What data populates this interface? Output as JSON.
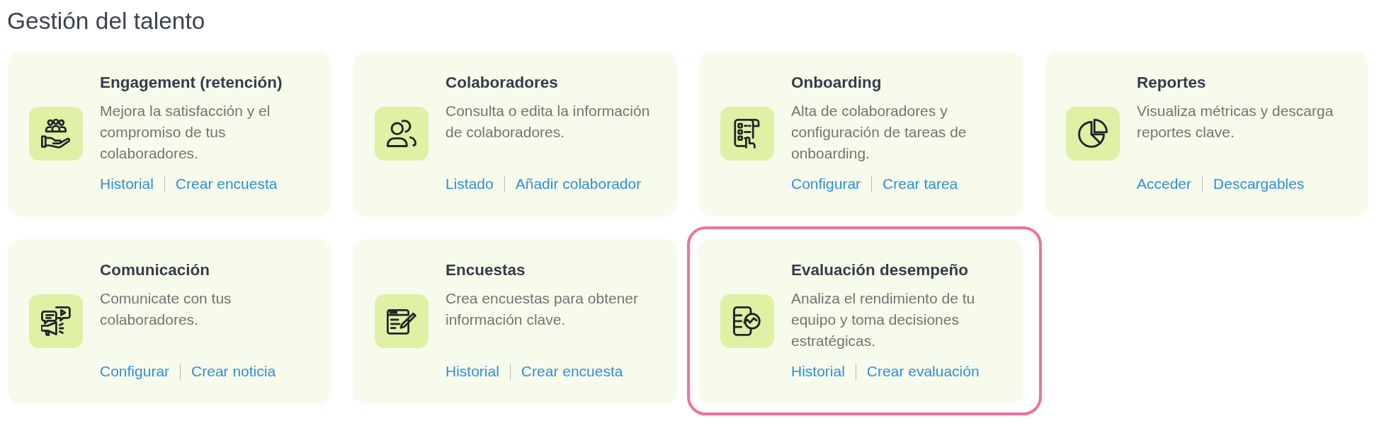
{
  "page": {
    "title": "Gestión del talento"
  },
  "cards": [
    {
      "title": "Engagement (retención)",
      "description": "Mejora la satisfacción y el compromiso de tus colaboradores.",
      "links": [
        "Historial",
        "Crear encuesta"
      ],
      "highlighted": false
    },
    {
      "title": "Colaboradores",
      "description": "Consulta o edita la información de colaboradores.",
      "links": [
        "Listado",
        "Añadir colaborador"
      ],
      "highlighted": false
    },
    {
      "title": "Onboarding",
      "description": "Alta de colaboradores y configuración de tareas de onboarding.",
      "links": [
        "Configurar",
        "Crear tarea"
      ],
      "highlighted": false
    },
    {
      "title": "Reportes",
      "description": "Visualiza métricas y descarga reportes clave.",
      "links": [
        "Acceder",
        "Descargables"
      ],
      "highlighted": false
    },
    {
      "title": "Comunicación",
      "description": "Comunicate con tus colaboradores.",
      "links": [
        "Configurar",
        "Crear noticia"
      ],
      "highlighted": false
    },
    {
      "title": "Encuestas",
      "description": "Crea encuestas para obtener información clave.",
      "links": [
        "Historial",
        "Crear encuesta"
      ],
      "highlighted": false
    },
    {
      "title": "Evaluación desempeño",
      "description": "Analiza el rendimiento de tu equipo y toma decisiones estratégicas.",
      "links": [
        "Historial",
        "Crear evaluación"
      ],
      "highlighted": true
    }
  ]
}
